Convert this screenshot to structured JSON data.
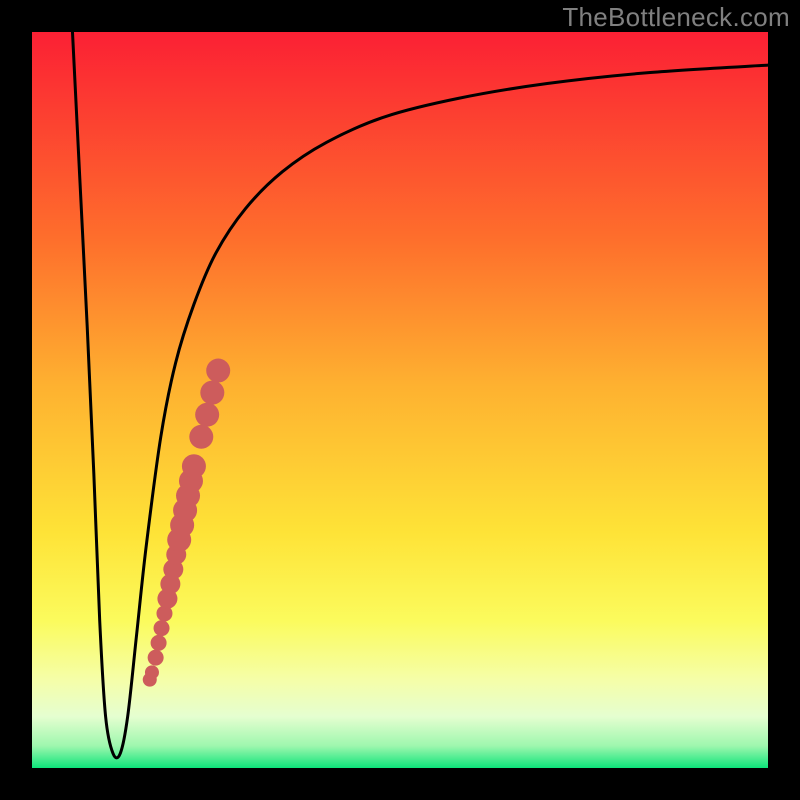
{
  "watermark": "TheBottleneck.com",
  "colors": {
    "frame": "#000000",
    "gradient_top": "#FB2034",
    "gradient_mid1": "#FE8C2B",
    "gradient_mid2": "#FEE337",
    "gradient_mid3": "#F8FD8F",
    "gradient_bottom_band": "#EFFEC6",
    "gradient_green": "#0DE47A",
    "curve": "#000000",
    "points": "#CD5C5C"
  },
  "chart_data": {
    "type": "line",
    "title": "",
    "xlabel": "",
    "ylabel": "",
    "xlim": [
      0,
      100
    ],
    "ylim": [
      0,
      100
    ],
    "grid": false,
    "legend": false,
    "series": [
      {
        "name": "bottleneck-curve",
        "x": [
          5.5,
          6.5,
          7.5,
          8.4,
          9.2,
          10.0,
          11.0,
          12.0,
          13.0,
          14.2,
          15.5,
          17.5,
          19.5,
          22.0,
          25.0,
          29.0,
          34.0,
          40.0,
          48.0,
          58.0,
          70.0,
          84.0,
          100.0
        ],
        "y": [
          100,
          80,
          60,
          40,
          20,
          7,
          2,
          2,
          7,
          18,
          30,
          45,
          55,
          63,
          70,
          76,
          81,
          85,
          88.5,
          91,
          93,
          94.5,
          95.5
        ]
      }
    ],
    "points": {
      "name": "highlighted-range",
      "x": [
        16.0,
        16.3,
        16.8,
        17.2,
        17.6,
        18.0,
        18.4,
        18.8,
        19.2,
        19.6,
        20.0,
        20.4,
        20.8,
        21.2,
        21.6,
        22.0,
        23.0,
        23.8,
        24.5,
        25.3
      ],
      "y": [
        12.0,
        13.0,
        15.0,
        17.0,
        19.0,
        21.0,
        23.0,
        25.0,
        27.0,
        29.0,
        31.0,
        33.0,
        35.0,
        37.0,
        39.0,
        41.0,
        45.0,
        48.0,
        51.0,
        54.0
      ],
      "size": [
        7,
        7,
        8,
        8,
        8,
        8,
        10,
        10,
        10,
        10,
        12,
        12,
        12,
        12,
        12,
        12,
        12,
        12,
        12,
        12
      ]
    },
    "annotations": []
  }
}
